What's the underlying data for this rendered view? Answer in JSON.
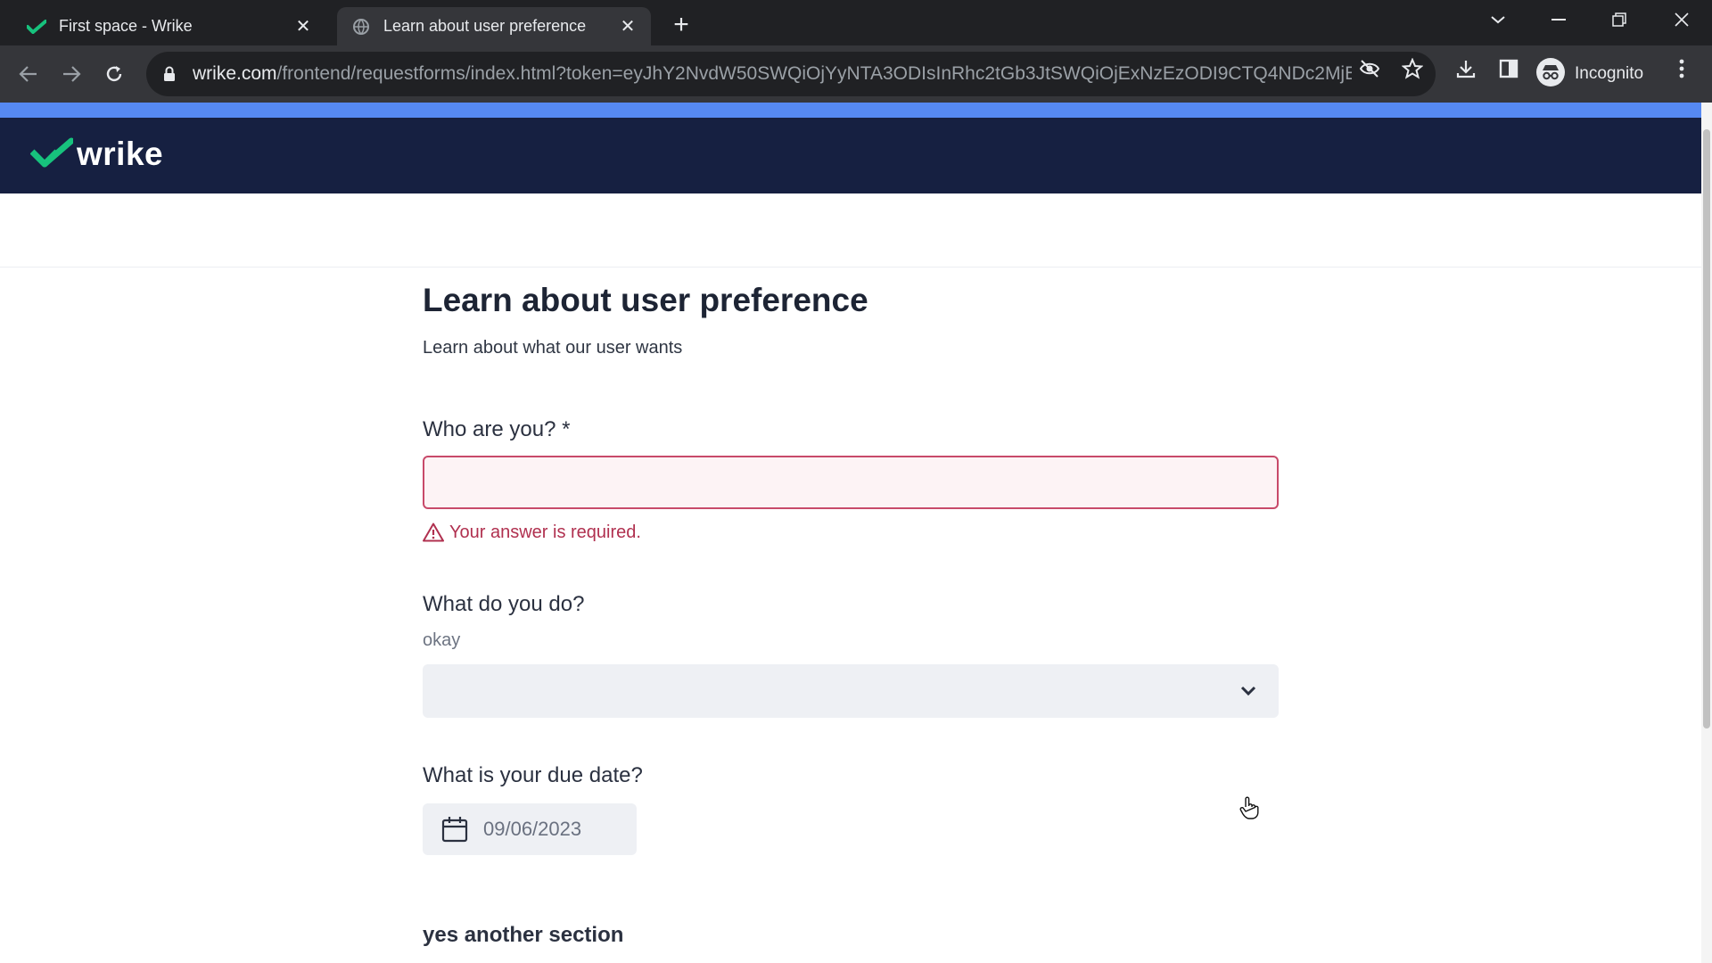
{
  "browser": {
    "tabs": [
      {
        "title": "First space - Wrike",
        "icon": "wrike-check-icon"
      },
      {
        "title": "Learn about user preference",
        "icon": "globe-icon"
      }
    ],
    "address": {
      "host": "wrike.com",
      "path": "/frontend/requestforms/index.html?token=eyJhY2NvdW50SWQiOjYyNTA3ODIsInRhc2tGb3JtSWQiOjExNzEzODI9CTQ4NDc2MjE..."
    },
    "profile_label": "Incognito"
  },
  "brand": {
    "name": "wrike",
    "colors": {
      "band": "#5689f2",
      "bar": "#162041",
      "check": "#17c27d"
    }
  },
  "form": {
    "title": "Learn about user preference",
    "description": "Learn about what our user wants",
    "questions": {
      "who": {
        "label": "Who are you? *",
        "value": "",
        "error": "Your answer is required."
      },
      "what": {
        "label": "What do you do?",
        "description": "okay",
        "selected": ""
      },
      "due": {
        "label": "What is your due date?",
        "value": "09/06/2023"
      }
    },
    "next_section": "yes another section"
  }
}
